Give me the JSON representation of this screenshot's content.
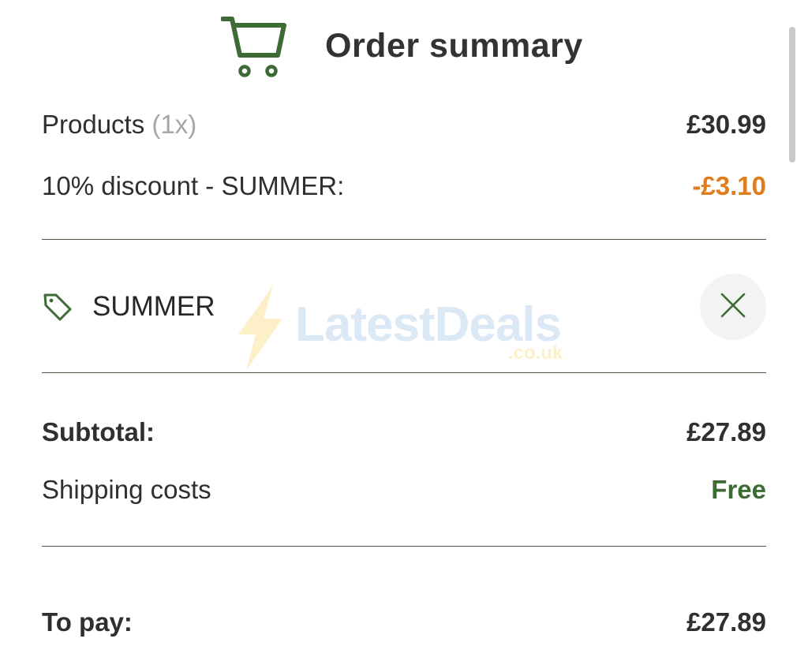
{
  "header": {
    "title": "Order summary",
    "icon": "shopping-cart-icon"
  },
  "summary": {
    "products_label": "Products",
    "products_qty": "(1x)",
    "products_price": "£30.99",
    "discount_label": "10% discount - SUMMER:",
    "discount_value": "-£3.10"
  },
  "coupon": {
    "code": "SUMMER",
    "icon": "tag-icon",
    "remove_icon": "close-icon"
  },
  "totals": {
    "subtotal_label": "Subtotal:",
    "subtotal_value": "£27.89",
    "shipping_label": "Shipping costs",
    "shipping_value": "Free",
    "to_pay_label": "To pay:",
    "to_pay_value": "£27.89"
  },
  "watermark": {
    "brand": "LatestDeals",
    "domain": ".co.uk"
  },
  "colors": {
    "accent_green": "#3e6a35",
    "discount_orange": "#e07c1a",
    "divider": "#4d5c44"
  }
}
